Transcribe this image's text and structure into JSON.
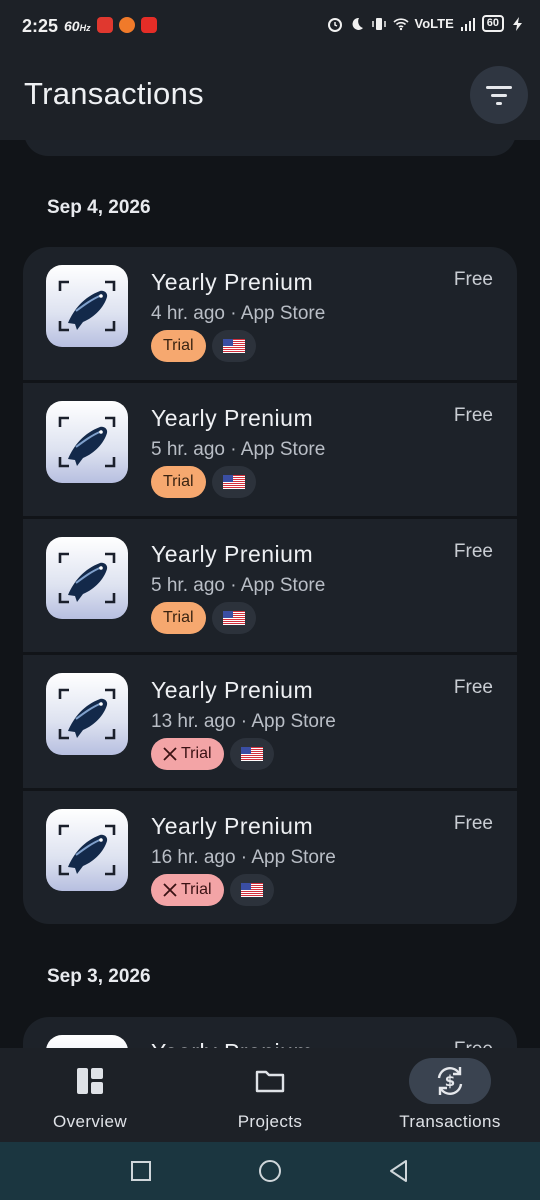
{
  "status_bar": {
    "time": "2:25",
    "refresh_rate": "60",
    "refresh_unit": "Hz",
    "network": "VoLTE",
    "battery": "60"
  },
  "header": {
    "title": "Transactions",
    "filter_icon": "filter-icon"
  },
  "groups": [
    {
      "date": "Sep 4, 2026",
      "transactions": [
        {
          "title": "Yearly Prenium",
          "subtitle": "4 hr. ago · App Store",
          "amount": "Free",
          "badge": "Trial",
          "badge_state": "active",
          "country": "US"
        },
        {
          "title": "Yearly Prenium",
          "subtitle": "5 hr. ago · App Store",
          "amount": "Free",
          "badge": "Trial",
          "badge_state": "active",
          "country": "US"
        },
        {
          "title": "Yearly Prenium",
          "subtitle": "5 hr. ago · App Store",
          "amount": "Free",
          "badge": "Trial",
          "badge_state": "active",
          "country": "US"
        },
        {
          "title": "Yearly Prenium",
          "subtitle": "13 hr. ago · App Store",
          "amount": "Free",
          "badge": "Trial",
          "badge_state": "cancelled",
          "country": "US"
        },
        {
          "title": "Yearly Prenium",
          "subtitle": "16 hr. ago · App Store",
          "amount": "Free",
          "badge": "Trial",
          "badge_state": "cancelled",
          "country": "US"
        }
      ]
    },
    {
      "date": "Sep 3, 2026",
      "transactions": [
        {
          "title": "Yearly Prenium",
          "subtitle": "",
          "amount": "Free",
          "badge": "",
          "badge_state": "",
          "country": ""
        }
      ]
    }
  ],
  "bottom_nav": {
    "items": [
      {
        "label": "Overview",
        "icon": "dashboard-icon",
        "active": false
      },
      {
        "label": "Projects",
        "icon": "folder-icon",
        "active": false
      },
      {
        "label": "Transactions",
        "icon": "currency-exchange-icon",
        "active": true
      }
    ]
  },
  "colors": {
    "background": "#111418",
    "card": "#1d2229",
    "trial_badge": "#f6a86f",
    "cancelled_badge": "#f3a4a6",
    "nav_active_pill": "#3a4350",
    "system_nav": "#1b3640"
  }
}
